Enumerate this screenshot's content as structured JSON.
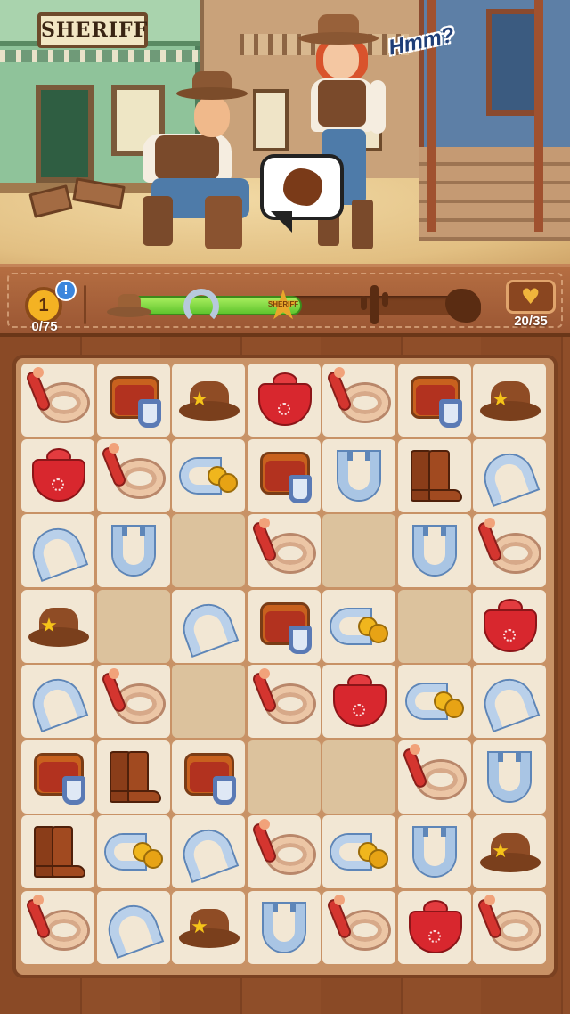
{
  "scene": {
    "sign_text": "SHERIFF",
    "thought_text": "Hmm?"
  },
  "hud": {
    "level": "1",
    "alert_badge": "!",
    "moves": "0/75",
    "progress_fraction": 0.5,
    "badge_label": "SHERIFF",
    "milestones": [
      "cowboy-hat-icon",
      "horseshoe-icon",
      "sheriff-badge-icon",
      "cactus-icon",
      "map-blob-icon"
    ],
    "collection": "20/35"
  },
  "board": {
    "rows": [
      [
        "rope",
        "saddle",
        "hat",
        "bandana",
        "rope",
        "saddle",
        "hat"
      ],
      [
        "bandana",
        "rope",
        "spurs",
        "saddle",
        "horseshoe",
        "boots",
        "spurs-u"
      ],
      [
        "spurs-u",
        "horseshoe",
        "empty",
        "rope",
        "empty",
        "horseshoe",
        "rope"
      ],
      [
        "hat",
        "empty",
        "spurs-u",
        "saddle",
        "spurs",
        "empty",
        "bandana"
      ],
      [
        "spurs-u",
        "rope",
        "empty",
        "rope",
        "bandana",
        "spurs",
        "spurs-u"
      ],
      [
        "saddle",
        "boots",
        "saddle",
        "empty",
        "empty",
        "rope",
        "horseshoe"
      ],
      [
        "boots",
        "spurs",
        "spurs-u",
        "rope",
        "spurs",
        "horseshoe",
        "hat"
      ],
      [
        "rope",
        "spurs-u",
        "hat",
        "horseshoe",
        "rope",
        "bandana",
        "rope"
      ]
    ]
  }
}
